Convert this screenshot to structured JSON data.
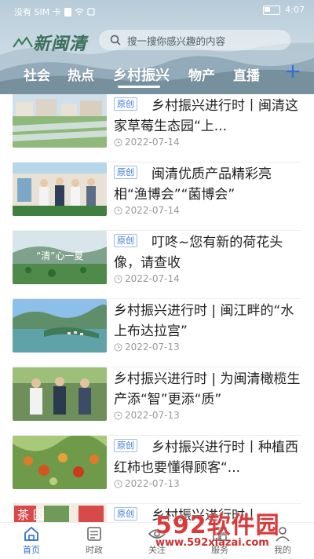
{
  "status_bar": {
    "carrier": "没有 SIM 卡",
    "time": "4:07"
  },
  "header": {
    "logo_text": "新闽清",
    "search_placeholder": "搜一搜你感兴趣的内容",
    "tabs": [
      {
        "label": "社会"
      },
      {
        "label": "热点"
      },
      {
        "label": "乡村振兴"
      },
      {
        "label": "物产"
      },
      {
        "label": "直播"
      }
    ],
    "active_tab": "乡村振兴"
  },
  "articles": [
    {
      "tag": "原创",
      "title": "乡村振兴进行时丨闽清这家草莓生态园“上...",
      "date": "2022-07-14",
      "thumb": "strawberry-greenhouse"
    },
    {
      "tag": "原创",
      "title": "闽清优质产品精彩亮相“渔博会”“菌博会”",
      "date": "2022-07-14",
      "thumb": "expo-booth"
    },
    {
      "tag": "原创",
      "title": "叮咚~您有新的荷花头像，请查收",
      "date": "2022-07-14",
      "thumb": "lotus-field",
      "thumb_text": "“清”心一夏"
    },
    {
      "tag": "",
      "title": "乡村振兴进行时 | 闽江畔的“水上布达拉宫”",
      "date": "2022-07-13",
      "thumb": "river-village"
    },
    {
      "tag": "",
      "title": "乡村振兴进行时 | 为闽清橄榄生产添“智”更添“质”",
      "date": "2022-07-13",
      "thumb": "olive-farm-visit"
    },
    {
      "tag": "原创",
      "title": "乡村振兴进行时丨种植西红柿也要懂得顾客“...",
      "date": "2022-07-13",
      "thumb": "tomato-plants"
    },
    {
      "tag": "原创",
      "title": "乡村振兴进行时丨...",
      "date": "",
      "thumb": "tea-garden",
      "thumb_text": "茶 园"
    }
  ],
  "bottom_nav": [
    {
      "label": "首页",
      "icon": "home-icon",
      "active": true
    },
    {
      "label": "时政",
      "icon": "newspaper-icon",
      "active": false
    },
    {
      "label": "关注",
      "icon": "eye-icon",
      "active": false
    },
    {
      "label": "服务",
      "icon": "grid-icon",
      "active": false
    },
    {
      "label": "我的",
      "icon": "user-icon",
      "active": false
    }
  ],
  "watermark": {
    "brand": "592软件园",
    "url": "www.592xiazai.com"
  },
  "colors": {
    "accent": "#2f6fd6",
    "tag_blue": "#3a7bd5",
    "watermark_red": "#d93a3a"
  }
}
